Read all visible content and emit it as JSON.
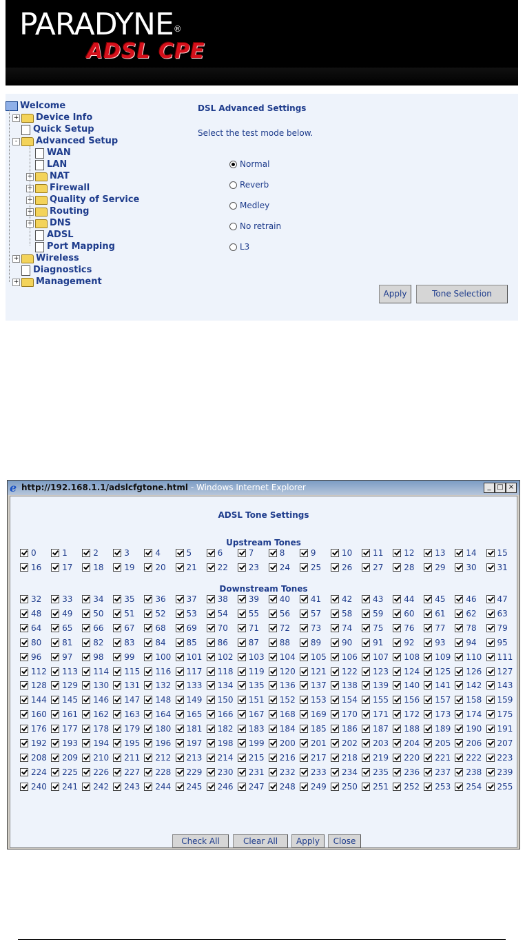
{
  "banner": {
    "brand": "PARADYNE",
    "registered": "®",
    "product": "ADSL CPE"
  },
  "nav": {
    "items": [
      {
        "label": "Welcome",
        "icon": "computer-icon",
        "level": 0,
        "expander": ""
      },
      {
        "label": "Device Info",
        "icon": "folder-icon",
        "level": 1,
        "expander": "+"
      },
      {
        "label": "Quick Setup",
        "icon": "document-icon",
        "level": 1,
        "expander": ""
      },
      {
        "label": "Advanced Setup",
        "icon": "folder-open-icon",
        "level": 1,
        "expander": "-"
      },
      {
        "label": "WAN",
        "icon": "document-icon",
        "level": 2,
        "expander": ""
      },
      {
        "label": "LAN",
        "icon": "document-icon",
        "level": 2,
        "expander": ""
      },
      {
        "label": "NAT",
        "icon": "folder-icon",
        "level": 2,
        "expander": "+"
      },
      {
        "label": "Firewall",
        "icon": "folder-icon",
        "level": 2,
        "expander": "+"
      },
      {
        "label": "Quality of Service",
        "icon": "folder-icon",
        "level": 2,
        "expander": "+"
      },
      {
        "label": "Routing",
        "icon": "folder-icon",
        "level": 2,
        "expander": "+"
      },
      {
        "label": "DNS",
        "icon": "folder-icon",
        "level": 2,
        "expander": "+"
      },
      {
        "label": "ADSL",
        "icon": "document-icon",
        "level": 2,
        "expander": ""
      },
      {
        "label": "Port Mapping",
        "icon": "document-icon",
        "level": 2,
        "expander": ""
      },
      {
        "label": "Wireless",
        "icon": "folder-icon",
        "level": 1,
        "expander": "+"
      },
      {
        "label": "Diagnostics",
        "icon": "document-icon",
        "level": 1,
        "expander": ""
      },
      {
        "label": "Management",
        "icon": "folder-icon",
        "level": 1,
        "expander": "+"
      }
    ]
  },
  "dsl": {
    "title": "DSL Advanced Settings",
    "instruction": "Select the test mode below.",
    "modes": [
      {
        "label": "Normal",
        "selected": true
      },
      {
        "label": "Reverb",
        "selected": false
      },
      {
        "label": "Medley",
        "selected": false
      },
      {
        "label": "No retrain",
        "selected": false
      },
      {
        "label": "L3",
        "selected": false
      }
    ],
    "apply_label": "Apply",
    "tone_selection_label": "Tone Selection"
  },
  "popup": {
    "window_title_url": "http://192.168.1.1/adslcfgtone.html",
    "window_title_suffix": " - Windows Internet Explorer",
    "minimize": "_",
    "maximize": "□",
    "close": "×",
    "title": "ADSL Tone Settings",
    "upstream_heading": "Upstream Tones",
    "downstream_heading": "Downstream Tones",
    "upstream_range": [
      0,
      31
    ],
    "downstream_range": [
      32,
      255
    ],
    "all_checked": true,
    "buttons": {
      "check_all": "Check All",
      "clear_all": "Clear All",
      "apply": "Apply",
      "close": "Close"
    }
  },
  "colors": {
    "text": "#1e3c8c",
    "panel": "#eef3fb",
    "banner_accent": "#d5101b"
  }
}
